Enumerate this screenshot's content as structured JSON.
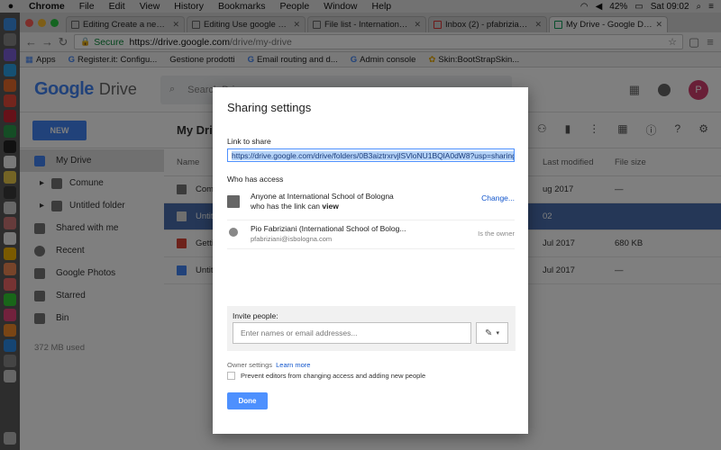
{
  "menubar": {
    "app": "Chrome",
    "items": [
      "File",
      "Edit",
      "View",
      "History",
      "Bookmarks",
      "People",
      "Window",
      "Help"
    ],
    "battery": "42%",
    "clock": "Sat 09:02"
  },
  "tabs": [
    {
      "title": "Editing Create a new one for",
      "active": false
    },
    {
      "title": "Editing Use google Drive for",
      "active": false
    },
    {
      "title": "File list - International Schoo",
      "active": false
    },
    {
      "title": "Inbox (2) - pfabriziani@isbol",
      "active": false
    },
    {
      "title": "My Drive - Google Drive",
      "active": true
    }
  ],
  "address": {
    "secure_label": "Secure",
    "host": "https://drive.google.com",
    "path": "/drive/my-drive"
  },
  "bookmarks": [
    {
      "label": "Apps"
    },
    {
      "label": "Register.it: Configu..."
    },
    {
      "label": "Gestione prodotti"
    },
    {
      "label": "Email routing and d..."
    },
    {
      "label": "Admin console"
    },
    {
      "label": "Skin:BootStrapSkin..."
    }
  ],
  "drive": {
    "logo_google": "Google",
    "logo_drive": "Drive",
    "search_placeholder": "Search Drive",
    "avatar_letter": "P",
    "new_label": "NEW",
    "my_drive_title": "My Drive",
    "sidebar": [
      {
        "label": "My Drive",
        "active": true
      },
      {
        "label": "Comune",
        "sub": true
      },
      {
        "label": "Untitled folder",
        "sub": true
      },
      {
        "label": "Shared with me"
      },
      {
        "label": "Recent"
      },
      {
        "label": "Google Photos"
      },
      {
        "label": "Starred"
      },
      {
        "label": "Bin"
      }
    ],
    "storage_used": "372 MB used",
    "columns": {
      "name": "Name",
      "modified": "Last modified",
      "size": "File size"
    },
    "rows": [
      {
        "name": "Comune",
        "modified": "ug 2017",
        "size": "—",
        "selected": false
      },
      {
        "name": "Untitled folder",
        "modified": "02",
        "size": "",
        "selected": true
      },
      {
        "name": "Getting started",
        "modified": "Jul 2017",
        "size": "680 KB",
        "selected": false
      },
      {
        "name": "Untitled document",
        "modified": "Jul 2017",
        "size": "—",
        "selected": false
      }
    ]
  },
  "dialog": {
    "title": "Sharing settings",
    "link_label": "Link to share",
    "link_url": "https://drive.google.com/drive/folders/0B3aiztrxrvjlSVloNU1BQlA0dW8?usp=sharing",
    "access_label": "Who has access",
    "access": [
      {
        "line1": "Anyone at International School of Bologna",
        "line2_prefix": "who has the link can ",
        "line2_bold": "view",
        "action": "Change..."
      },
      {
        "line1": "Pio Fabriziani (International School of Bolog...",
        "line2": "pfabriziani@isbologna.com",
        "role": "Is the owner"
      }
    ],
    "invite_label": "Invite people:",
    "invite_placeholder": "Enter names or email addresses...",
    "owner_settings": "Owner settings",
    "learn_more": "Learn more",
    "prevent_label": "Prevent editors from changing access and adding new people",
    "done_label": "Done"
  },
  "colors": {
    "accent": "#4d90fe",
    "new_button": "#4285f4",
    "selected_row": "#4a6fae",
    "avatar": "#d23f6f"
  }
}
